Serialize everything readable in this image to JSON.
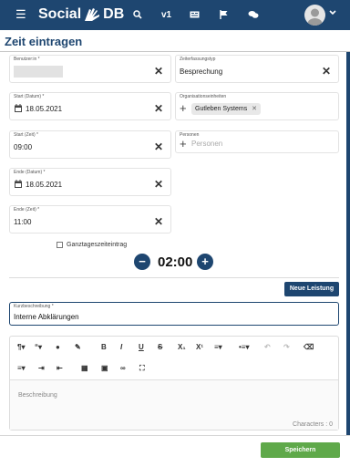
{
  "header": {
    "brand_left": "Social",
    "brand_right": "DB",
    "version_label": "v1"
  },
  "page": {
    "title": "Zeit eintragen"
  },
  "form": {
    "benutzer": {
      "label": "Benutzer:in *",
      "value": ""
    },
    "zeiterfassungstyp": {
      "label": "Zeiterfassungstyp",
      "value": "Besprechung"
    },
    "start_datum": {
      "label": "Start (Datum) *",
      "value": "18.05.2021"
    },
    "organisationseinheiten": {
      "label": "Organisationseinheiten",
      "chip": "Gutleben Systems"
    },
    "start_zeit": {
      "label": "Start (Zeit) *",
      "value": "09:00"
    },
    "personen": {
      "label": "Personen",
      "placeholder": "Personen"
    },
    "ende_datum": {
      "label": "Ende (Datum) *",
      "value": "18.05.2021"
    },
    "ende_zeit": {
      "label": "Ende (Zeit) *",
      "value": "11:00"
    },
    "ganztag_label": "Ganztageszeiteintrag",
    "duration": "02:00",
    "neue_leistung": "Neue Leistung",
    "kurzbeschreibung": {
      "label": "Kurzbeschreibung *",
      "value": "Interne Abklärungen"
    },
    "beschreibung": {
      "placeholder": "Beschreibung",
      "characters": "Characters : 0"
    }
  },
  "footer": {
    "save_label": "Speichern"
  },
  "colors": {
    "primary": "#1e4670",
    "save": "#5fa94a"
  }
}
